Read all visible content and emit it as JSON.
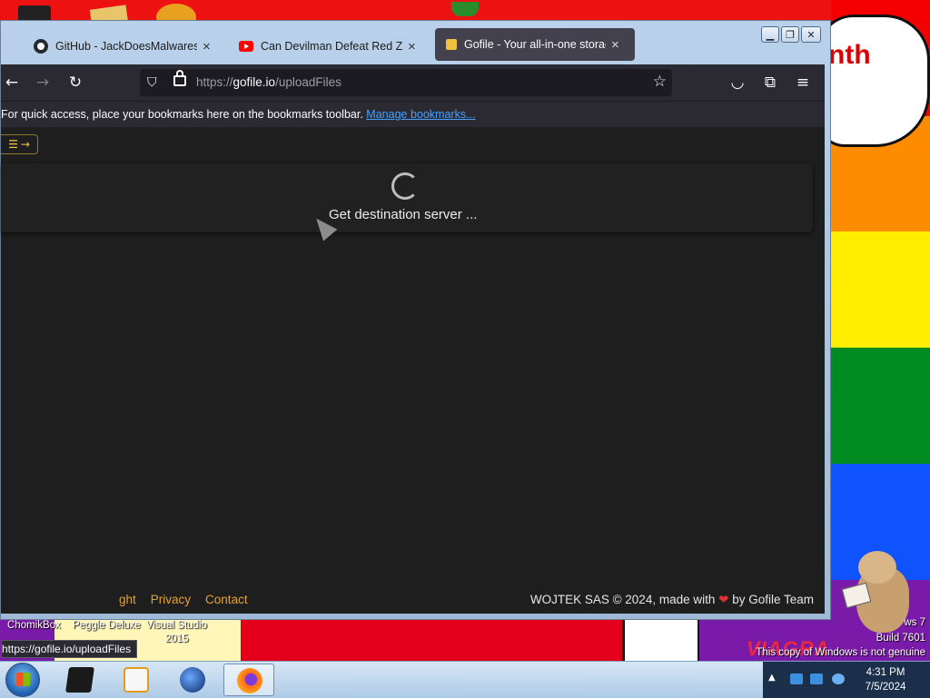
{
  "browser": {
    "tabs": [
      {
        "title": "GitHub - JackDoesMalwares/Gu",
        "icon": "github-icon",
        "active": false
      },
      {
        "title": "Can Devilman Defeat Red Zone",
        "icon": "youtube-icon",
        "active": false
      },
      {
        "title": "Gofile - Your all-in-one storage",
        "icon": "gofile-icon",
        "active": true
      }
    ],
    "url": {
      "protocol": "https://",
      "host": "gofile.io",
      "path": "/uploadFiles"
    },
    "bookmarks_bar": {
      "message": "For quick access, place your bookmarks here on the bookmarks toolbar.",
      "link_text": "Manage bookmarks..."
    },
    "status_link": "https://gofile.io/uploadFiles"
  },
  "page": {
    "status": "Get destination server ...",
    "footer": {
      "links": [
        "ght",
        "Privacy",
        "Contact"
      ],
      "copyright_prefix": "WOJTEK SAS © 2024, made with",
      "copyright_suffix": "by Gofile Team"
    }
  },
  "desktop": {
    "wallpaper_text": "nth",
    "icons": [
      "ChomikBox",
      "Peggle Deluxe",
      "Visual Studio",
      "2015"
    ],
    "windows_version": [
      "ws 7",
      "Build 7601",
      "This copy of Windows is not genuine"
    ],
    "graffiti": "VIAGRA"
  },
  "taskbar": {
    "apps": [
      {
        "name": "app-black-icon",
        "active": false
      },
      {
        "name": "media-player-icon",
        "active": false
      },
      {
        "name": "globe-icon",
        "active": false
      },
      {
        "name": "firefox-icon",
        "active": true
      }
    ],
    "clock": {
      "time": "4:31 PM",
      "date": "7/5/2024"
    }
  },
  "colors": {
    "accent_link": "#45a1ff",
    "footer_link": "#e4a335",
    "browser_bg": "#1c1b22"
  }
}
